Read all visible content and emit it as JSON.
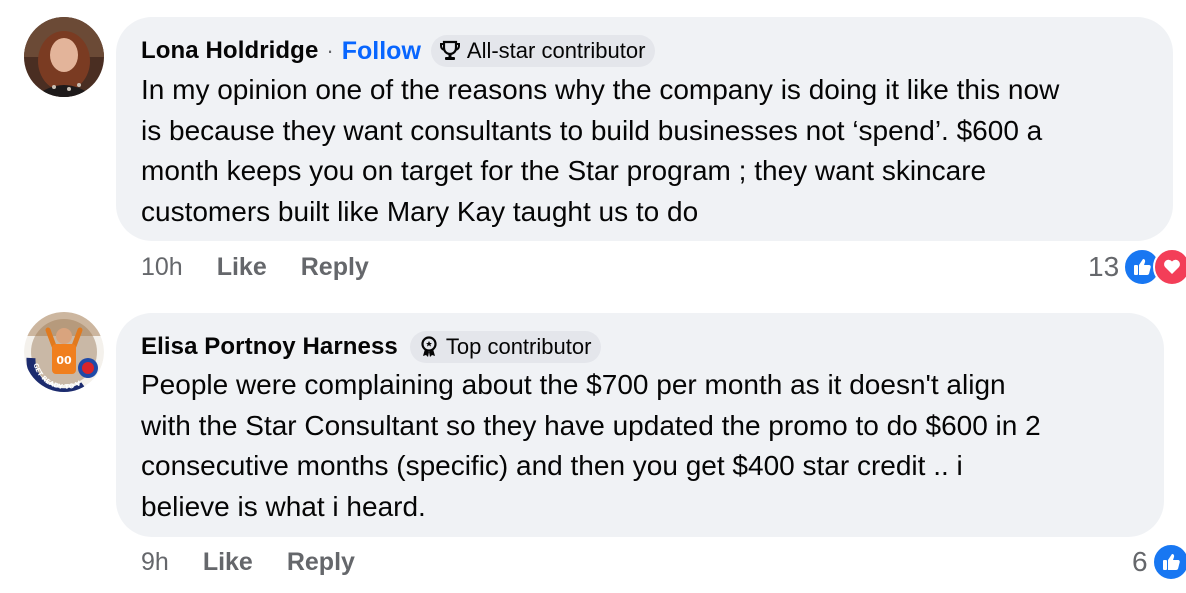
{
  "comments": [
    {
      "author": "Lona Holdridge",
      "separator": "·",
      "follow_label": "Follow",
      "badge": "All-star contributor",
      "text_lines": [
        "In my opinion one of the reasons why the company is doing it like this now",
        "is because they want consultants to build businesses not ‘spend’. $600 a",
        "month keeps you on target for the Star program ; they want skincare",
        "customers built like Mary Kay taught us to do"
      ],
      "time": "10h",
      "like_label": "Like",
      "reply_label": "Reply",
      "reaction_count": "13",
      "reactions": [
        "like-icon",
        "love-icon"
      ]
    },
    {
      "author": "Elisa Portnoy Harness",
      "badge": "Top contributor",
      "avatar_text": "GET READY TO VOTE",
      "text_lines": [
        "People were complaining about the $700 per month as it doesn't align",
        "with the Star Consultant so they have updated the promo to do $600 in 2",
        "consecutive months (specific) and then you get $400 star credit .. i",
        "believe is what i heard."
      ],
      "time": "9h",
      "like_label": "Like",
      "reply_label": "Reply",
      "reaction_count": "6",
      "reactions": [
        "like-icon"
      ]
    }
  ],
  "colors": {
    "bubble": "#f0f2f5",
    "link": "#0866ff",
    "meta": "#65676b",
    "like": "#1877f2",
    "love": "#f33e58"
  }
}
